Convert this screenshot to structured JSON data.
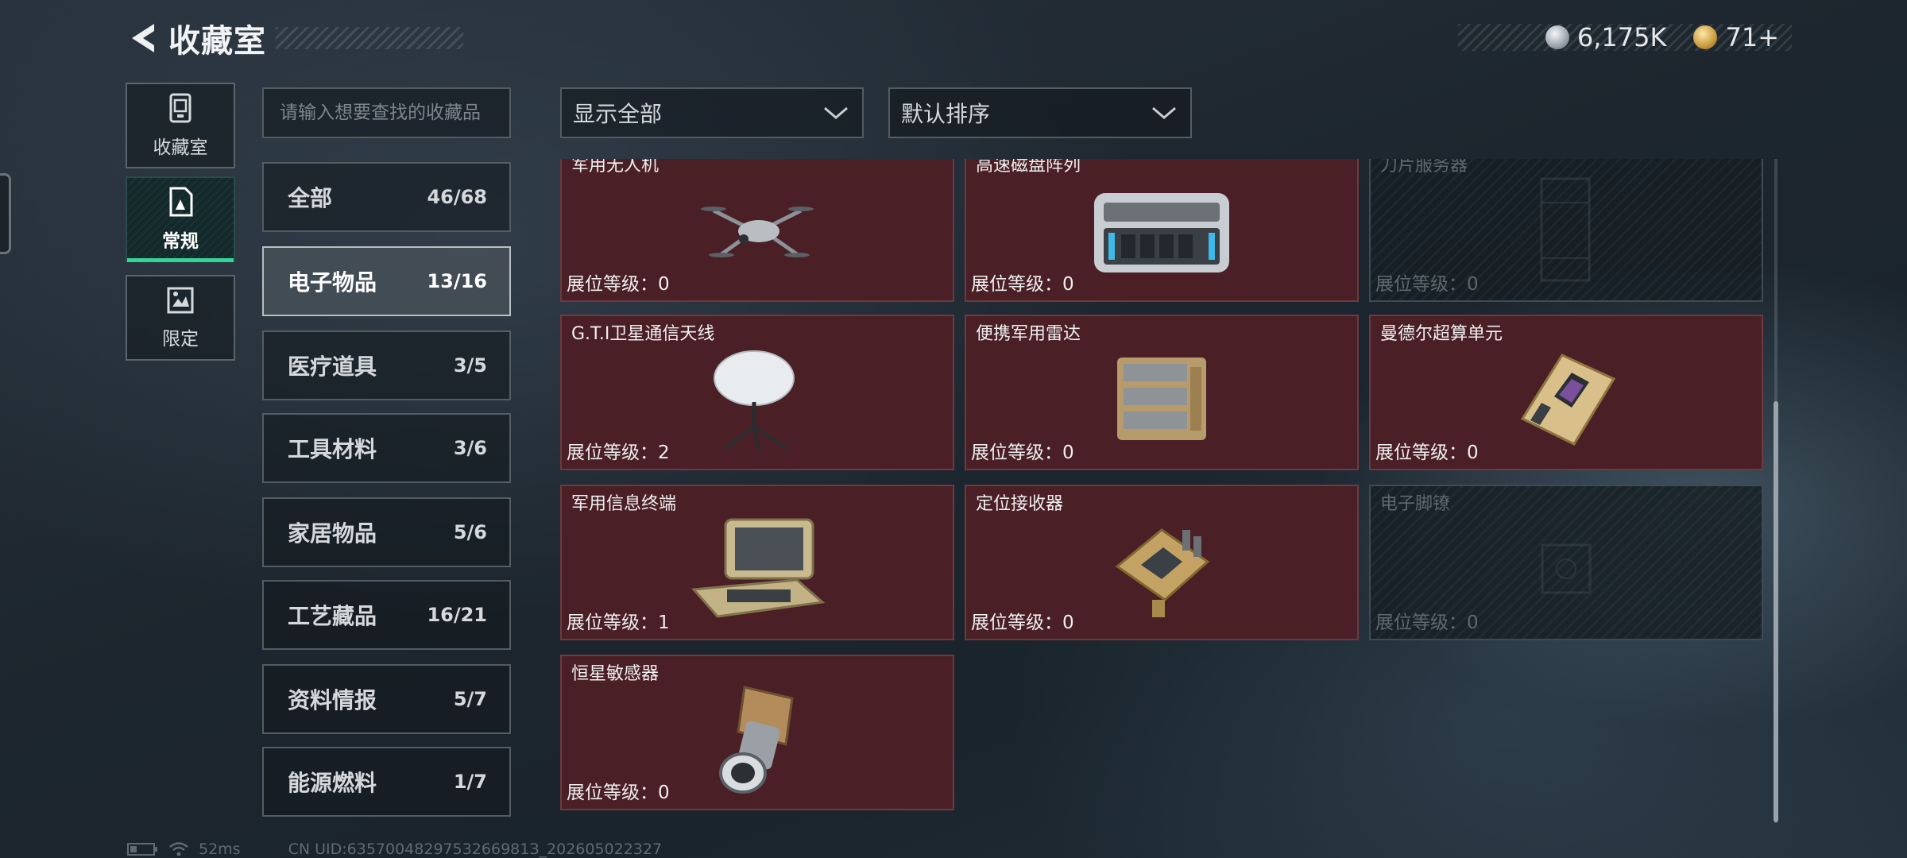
{
  "header": {
    "title": "收藏室",
    "currency": [
      {
        "icon": "silver-coin-icon",
        "value": "6,175K"
      },
      {
        "icon": "gold-coin-icon",
        "value": "71+"
      }
    ]
  },
  "side_tabs": [
    {
      "label": "收藏室",
      "icon": "collection-room-icon"
    },
    {
      "label": "常规",
      "icon": "regular-doc-icon",
      "active": true
    },
    {
      "label": "限定",
      "icon": "limited-icon"
    }
  ],
  "search": {
    "placeholder": "请输入想要查找的收藏品"
  },
  "filters": {
    "show": "显示全部",
    "sort": "默认排序"
  },
  "categories": [
    {
      "name": "全部",
      "count": "46/68"
    },
    {
      "name": "电子物品",
      "count": "13/16",
      "active": true
    },
    {
      "name": "医疗道具",
      "count": "3/5"
    },
    {
      "name": "工具材料",
      "count": "3/6"
    },
    {
      "name": "家居物品",
      "count": "5/6"
    },
    {
      "name": "工艺藏品",
      "count": "16/21"
    },
    {
      "name": "资料情报",
      "count": "5/7"
    },
    {
      "name": "能源燃料",
      "count": "1/7"
    }
  ],
  "items": [
    {
      "name": "军用无人机",
      "level": "展位等级：0",
      "icon": "drone-icon",
      "collected": true
    },
    {
      "name": "高速磁盘阵列",
      "level": "展位等级：0",
      "icon": "disk-array-icon",
      "collected": true
    },
    {
      "name": "刀片服务器",
      "level": "展位等级：0",
      "icon": "blade-server-icon",
      "collected": false
    },
    {
      "name": "G.T.I卫星通信天线",
      "level": "展位等级：2",
      "icon": "satellite-antenna-icon",
      "collected": true
    },
    {
      "name": "便携军用雷达",
      "level": "展位等级：0",
      "icon": "radar-icon",
      "collected": true
    },
    {
      "name": "曼德尔超算单元",
      "level": "展位等级：0",
      "icon": "supercomputer-unit-icon",
      "collected": true
    },
    {
      "name": "军用信息终端",
      "level": "展位等级：1",
      "icon": "info-terminal-icon",
      "collected": true
    },
    {
      "name": "定位接收器",
      "level": "展位等级：0",
      "icon": "positioning-receiver-icon",
      "collected": true
    },
    {
      "name": "电子脚镣",
      "level": "展位等级：0",
      "icon": "electronic-shackle-icon",
      "collected": false
    },
    {
      "name": "恒星敏感器",
      "level": "展位等级：0",
      "icon": "star-sensor-icon",
      "collected": true
    }
  ],
  "status": {
    "ping": "52ms",
    "uid": "CN UID:6357004829753266981З_202605022327"
  }
}
